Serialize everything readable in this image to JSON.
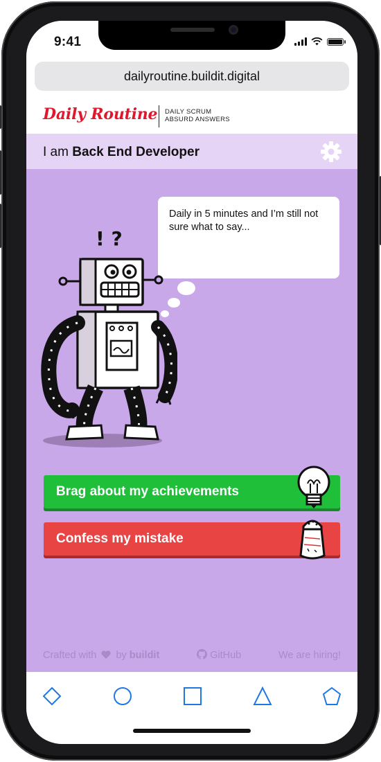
{
  "status": {
    "time": "9:41"
  },
  "browser": {
    "url": "dailyroutine.buildit.digital"
  },
  "header": {
    "logo": "Daily Routine",
    "tagline_line1": "DAILY SCRUM",
    "tagline_line2": "ABSURD ANSWERS"
  },
  "role": {
    "prefix": "I am ",
    "name": "Back End Developer"
  },
  "bubble": {
    "text": "Daily in 5 minutes and I’m still not sure what to say..."
  },
  "robot": {
    "marks": "! ?"
  },
  "actions": {
    "brag": "Brag about my achievements",
    "confess": "Confess my mistake"
  },
  "footer": {
    "crafted": "Crafted with",
    "by": "by",
    "brand": "buildit",
    "github": "GitHub",
    "hiring": "We are hiring!"
  },
  "icons": {
    "settings": "gear-icon",
    "heart": "heart-icon",
    "github": "github-icon",
    "tabs": [
      "diamond-icon",
      "circle-icon",
      "square-icon",
      "triangle-icon",
      "pentagon-icon"
    ]
  },
  "colors": {
    "brand_red": "#e0182d",
    "background": "#c9a8ea",
    "role_bar": "#e5d4f5",
    "brag": "#1fbf3a",
    "confess": "#e84444",
    "footer_text": "#a98bc8",
    "tab_icons": "#1e78e0"
  }
}
